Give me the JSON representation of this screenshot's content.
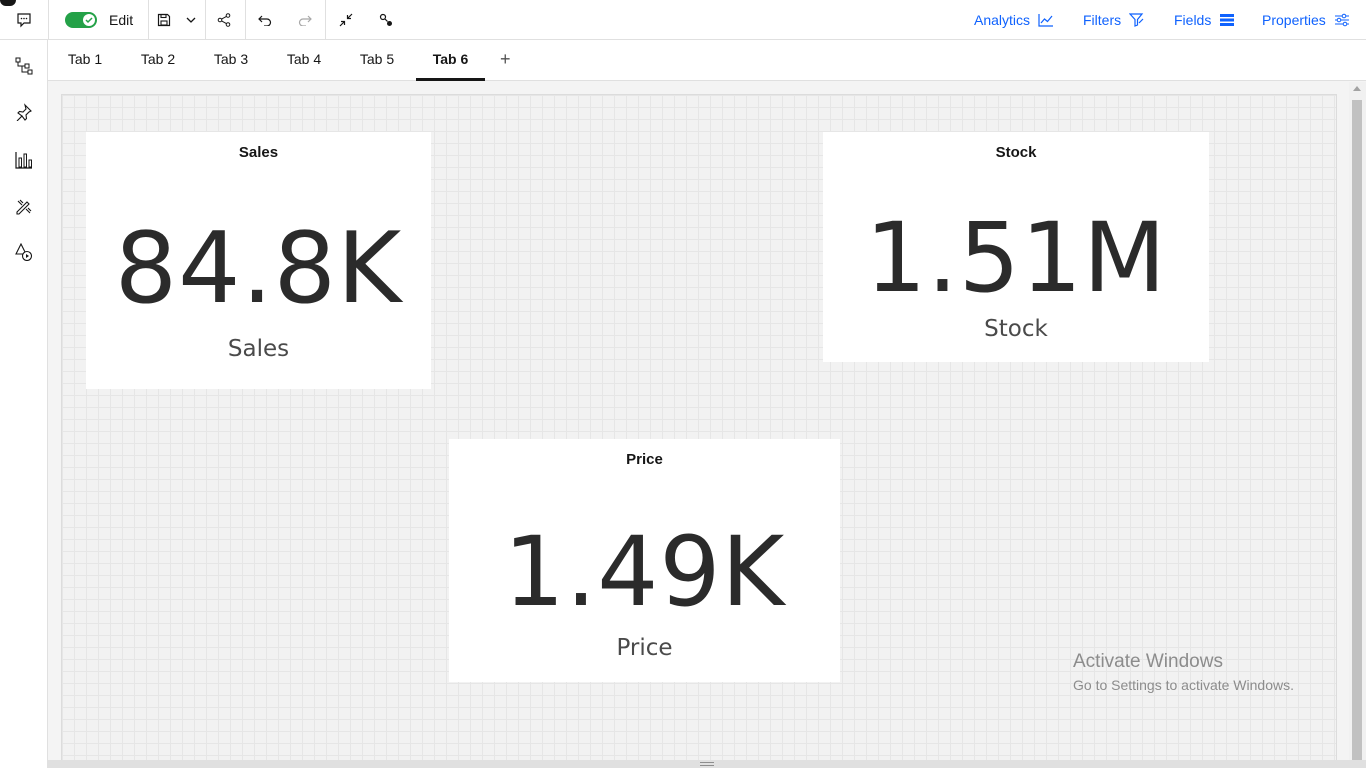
{
  "toolbar": {
    "edit_label": "Edit",
    "edit_on": true,
    "right_links": {
      "analytics": "Analytics",
      "filters": "Filters",
      "fields": "Fields",
      "properties": "Properties"
    }
  },
  "rail": {
    "icons": [
      "comment-icon",
      "tree-icon",
      "pin-icon",
      "bar-chart-icon",
      "edit-tools-icon",
      "shapes-play-icon"
    ]
  },
  "tabs": {
    "items": [
      "Tab 1",
      "Tab 2",
      "Tab 3",
      "Tab 4",
      "Tab 5",
      "Tab 6"
    ],
    "active": "Tab 6",
    "add_label": "+"
  },
  "cards": {
    "sales": {
      "title": "Sales",
      "value": "84.8K",
      "label": "Sales"
    },
    "stock": {
      "title": "Stock",
      "value": "1.51M",
      "label": "Stock"
    },
    "price": {
      "title": "Price",
      "value": "1.49K",
      "label": "Price"
    }
  },
  "watermark": {
    "line1": "Activate Windows",
    "line2": "Go to Settings to activate Windows."
  },
  "colors": {
    "accent": "#0f62fe",
    "toggle_on": "#24a148",
    "value_text": "#2b2b2b"
  }
}
